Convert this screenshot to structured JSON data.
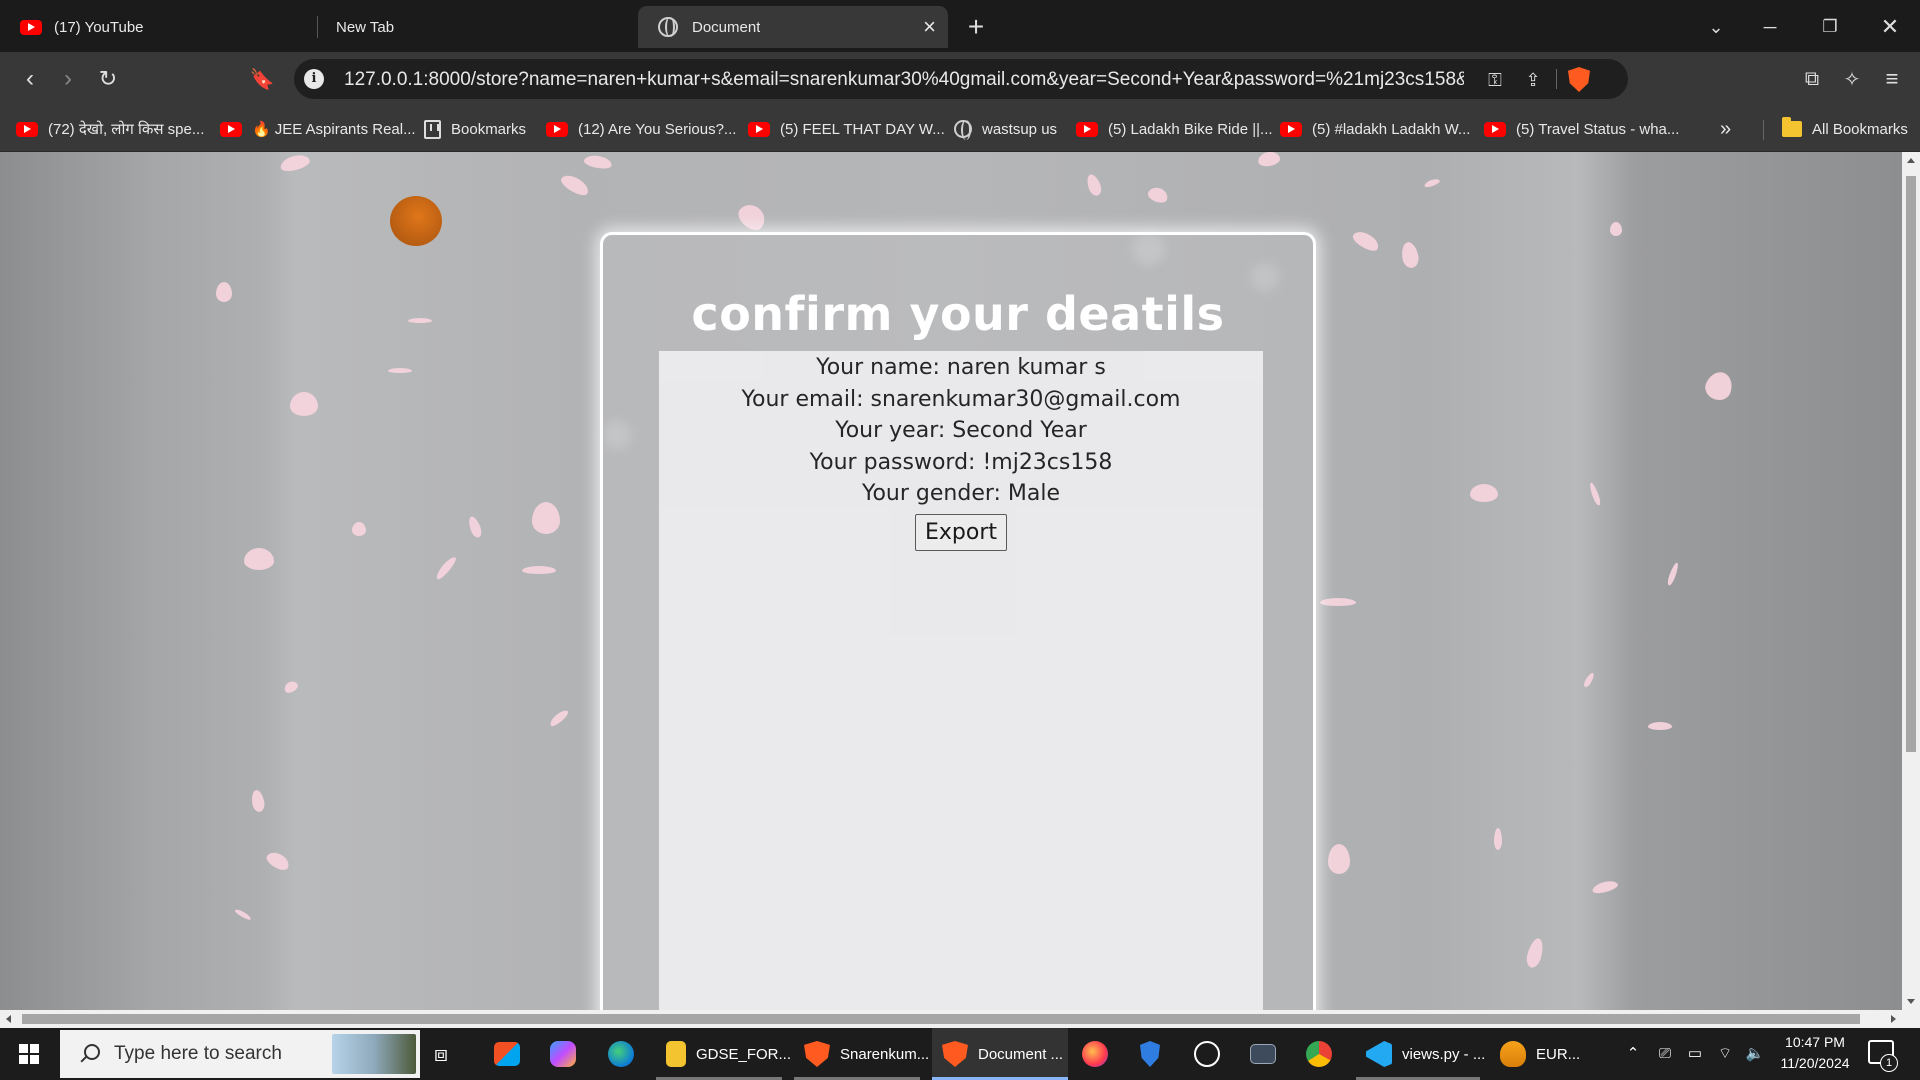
{
  "browser": {
    "tabs": [
      {
        "title": "(17) YouTube",
        "icon": "youtube-icon",
        "active": false
      },
      {
        "title": "New Tab",
        "icon": "",
        "active": false
      },
      {
        "title": "Document",
        "icon": "globe-icon",
        "active": true
      }
    ],
    "url": "127.0.0.1:8000/store?name=naren+kumar+s&email=snarenkumar30%40gmail.com&year=Second+Year&password=%21mj23cs158&g...",
    "bookmarks": [
      {
        "label": "(72) देखो, लोग किस spe...",
        "icon": "youtube-icon"
      },
      {
        "label": "JEE Aspirants Real...",
        "icon": "youtube-icon",
        "prefix": "🔥"
      },
      {
        "label": "Bookmarks",
        "icon": "bookmarks-icon"
      },
      {
        "label": "(12) Are You Serious?...",
        "icon": "youtube-icon"
      },
      {
        "label": "(5) FEEL THAT DAY W...",
        "icon": "youtube-icon"
      },
      {
        "label": "wastsup us",
        "icon": "globe-icon"
      },
      {
        "label": "(5) Ladakh Bike Ride ||...",
        "icon": "youtube-icon"
      },
      {
        "label": "(5) #ladakh Ladakh W...",
        "icon": "youtube-icon"
      },
      {
        "label": "(5) Travel Status - wha...",
        "icon": "youtube-icon"
      }
    ],
    "all_bookmarks": "All Bookmarks",
    "colors": {
      "youtube": "#ff0000",
      "brave": "#ff5a1f",
      "folder": "#f4c430"
    }
  },
  "page": {
    "heading": "confirm your deatils",
    "details": [
      "Your name: naren kumar s",
      "Your email: snarenkumar30@gmail.com",
      "Your year: Second Year",
      "Your password: !mj23cs158",
      "Your gender: Male"
    ],
    "export_label": "Export"
  },
  "taskbar": {
    "search_placeholder": "Type here to search",
    "apps": [
      {
        "label": "GDSE_FOR...",
        "icon": "folder-icon"
      },
      {
        "label": "Snarenkum...",
        "icon": "brave-icon"
      },
      {
        "label": "Document ...",
        "icon": "brave-icon"
      },
      {
        "label": "views.py - ...",
        "icon": "vscode-icon"
      },
      {
        "label": "EUR...",
        "icon": "currency-icon"
      }
    ],
    "time": "10:47 PM",
    "date": "11/20/2024",
    "notification_count": "1"
  }
}
